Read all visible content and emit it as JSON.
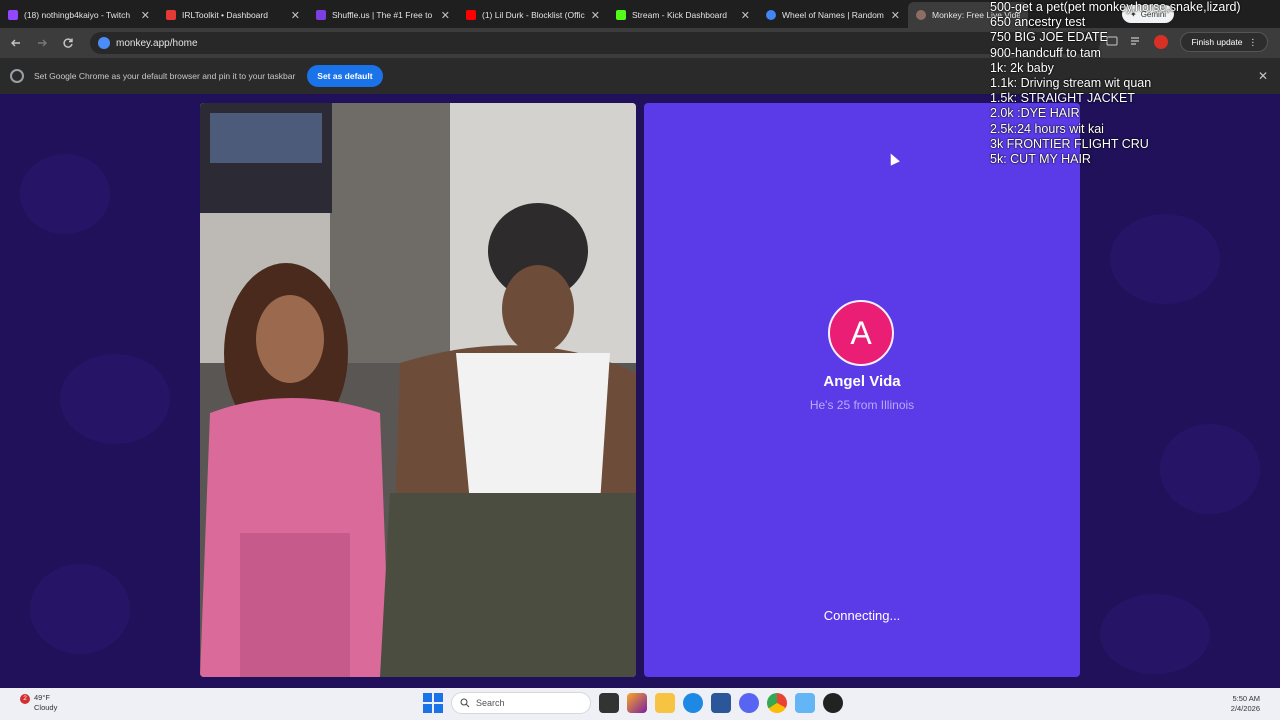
{
  "browser": {
    "tabs": [
      {
        "title": "(18) nothingb4kaiyo - Twitch",
        "favicon_color": "#9146ff",
        "active": false
      },
      {
        "title": "IRLToolkit • Dashboard",
        "favicon_color": "#e53935",
        "active": false
      },
      {
        "title": "Shuffle.us | The #1 Free to Pl",
        "favicon_color": "#7b3fe4",
        "active": false
      },
      {
        "title": "(1) Lil Durk - Blocklist (Offici",
        "favicon_color": "#ff0000",
        "active": false
      },
      {
        "title": "Stream - Kick Dashboard",
        "favicon_color": "#53fc18",
        "active": false
      },
      {
        "title": "Wheel of Names | Random n",
        "favicon_color": "#4285f4",
        "active": false
      },
      {
        "title": "Monkey: Free Live Vide",
        "favicon_color": "#8d6e63",
        "active": true
      }
    ],
    "close_glyph": "✕",
    "url": "monkey.app/home",
    "finish_update": "Finish update",
    "gemini": "Gemini",
    "infobar": {
      "message": "Set Google Chrome as your default browser and pin it to your taskbar",
      "button": "Set as default"
    }
  },
  "page": {
    "peer": {
      "initial": "A",
      "name": "Angel Vida",
      "subtitle": "He's 25 from Illinois",
      "status": "Connecting..."
    },
    "colors": {
      "background": "#20115a",
      "card": "#5b3be8",
      "avatar": "#e91e74"
    }
  },
  "overlay": {
    "lines": [
      "500-get a pet(pet monkey,horse,snake,lizard)",
      "650 ancestry test",
      "750 BIG JOE EDATE",
      "900-handcuff to tam",
      "1k: 2k baby",
      "1.1k: Driving stream wit quan",
      "1.5k: STRAIGHT JACKET",
      "2.0k :DYE HAIR",
      "2.5k:24 hours wit kai",
      "3k FRONTIER FLIGHT CRU",
      "5k: CUT MY HAIR"
    ]
  },
  "taskbar": {
    "weather_badge": "2",
    "temperature": "49°F",
    "condition": "Cloudy",
    "search_placeholder": "Search",
    "time": "5:50 AM",
    "date": "2/4/2026"
  }
}
